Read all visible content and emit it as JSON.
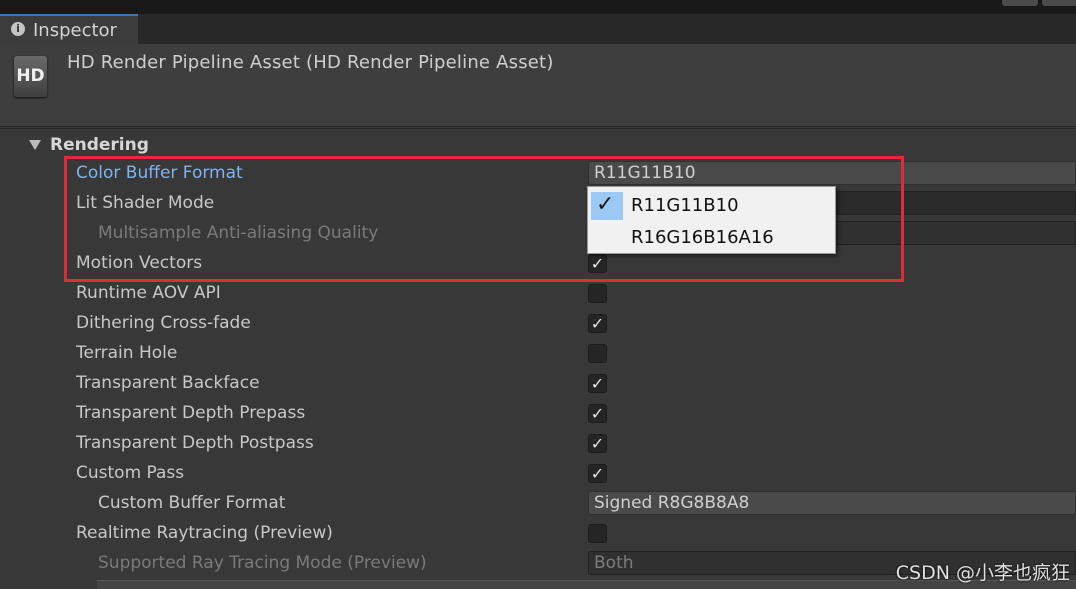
{
  "tab": {
    "label": "Inspector",
    "icon": "info-icon"
  },
  "header": {
    "icon_text": "HD",
    "title": "HD Render Pipeline Asset (HD Render Pipeline Asset)"
  },
  "section": {
    "title": "Rendering"
  },
  "rows": {
    "color_buffer_format": {
      "label": "Color Buffer Format",
      "value": "R11G11B10"
    },
    "lit_shader_mode": {
      "label": "Lit Shader Mode"
    },
    "msaa_quality": {
      "label": "Multisample Anti-aliasing Quality"
    },
    "motion_vectors": {
      "label": "Motion Vectors",
      "checked": true
    },
    "runtime_aov": {
      "label": "Runtime AOV API",
      "checked": false
    },
    "dithering": {
      "label": "Dithering Cross-fade",
      "checked": true
    },
    "terrain_hole": {
      "label": "Terrain Hole",
      "checked": false
    },
    "transparent_backface": {
      "label": "Transparent Backface",
      "checked": true
    },
    "transparent_depth_prepass": {
      "label": "Transparent Depth Prepass",
      "checked": true
    },
    "transparent_depth_postpass": {
      "label": "Transparent Depth Postpass",
      "checked": true
    },
    "custom_pass": {
      "label": "Custom Pass",
      "checked": true
    },
    "custom_buffer_format": {
      "label": "Custom Buffer Format",
      "value": "Signed R8G8B8A8"
    },
    "realtime_raytracing": {
      "label": "Realtime Raytracing (Preview)",
      "checked": false
    },
    "ray_tracing_mode": {
      "label": "Supported Ray Tracing Mode (Preview)",
      "value": "Both"
    }
  },
  "dropdown": {
    "options": [
      {
        "label": "R11G11B10",
        "selected": true
      },
      {
        "label": "R16G16B16A16",
        "selected": false
      }
    ],
    "check_glyph": "✓"
  },
  "check_glyph": "✓",
  "watermark": "CSDN @小李也疯狂",
  "colors": {
    "highlight": "#e12b3b",
    "active_label": "#7db4f0",
    "selected_option": "#9bc8f4"
  }
}
